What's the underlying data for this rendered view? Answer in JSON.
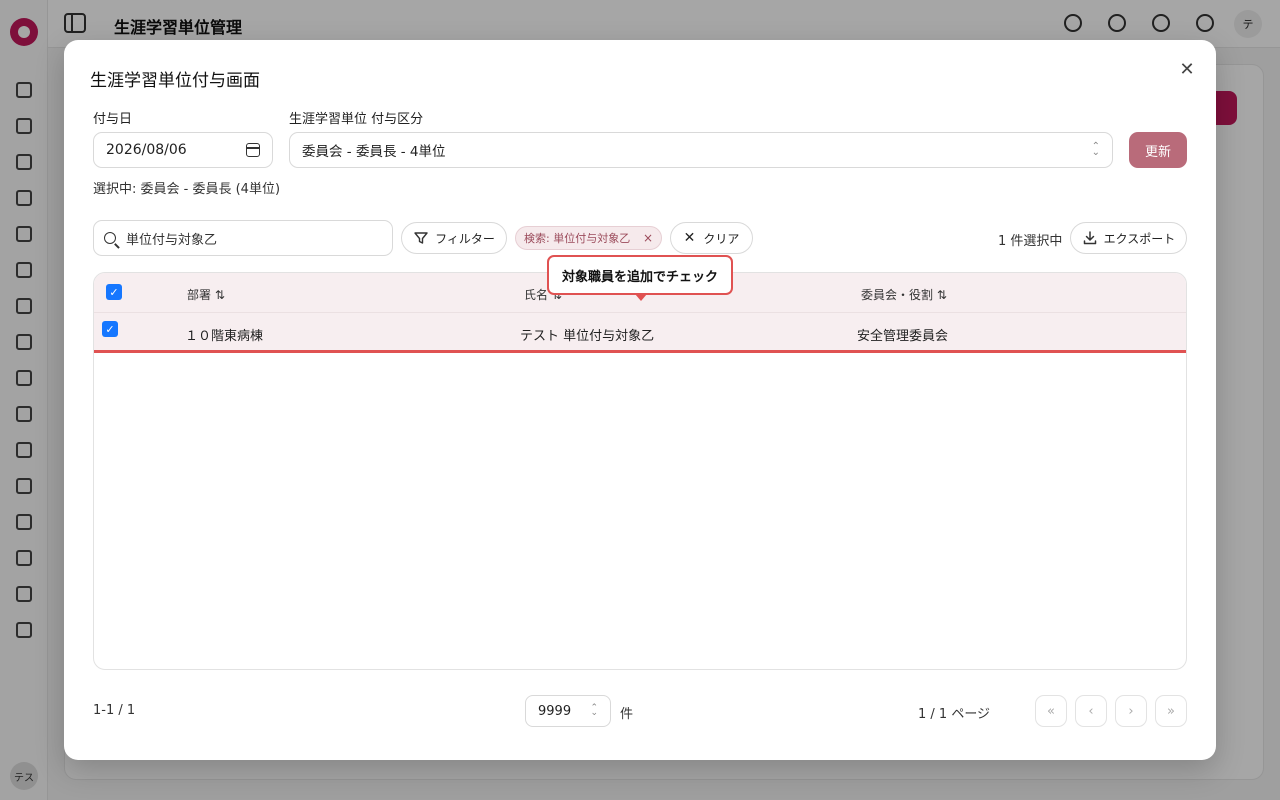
{
  "app": {
    "title": "生涯学習単位管理",
    "user_initials": "テ",
    "sidebar_user_initials": "テス"
  },
  "dialog": {
    "title": "生涯学習単位付与画面",
    "close_glyph": "✕",
    "date_label": "付与日",
    "date_value": "2026/08/06",
    "category_label": "生涯学習単位 付与区分",
    "category_value": "委員会 - 委員長 - 4単位",
    "update_label": "更新",
    "selected_info": "選択中: 委員会 - 委員長 (4単位)"
  },
  "toolbar": {
    "search_value": "単位付与対象乙",
    "filter_label": "フィルター",
    "chip_label": "検索: 単位付与対象乙",
    "chip_close": "×",
    "clear_label": "クリア",
    "clear_glyph": "✕",
    "selection_count": "1 件選択中",
    "export_label": "エクスポート"
  },
  "table": {
    "headers": [
      "部署 ⇅",
      "氏名 ⇅",
      "委員会・役割 ⇅"
    ],
    "rows": [
      {
        "checked": true,
        "cells": [
          "１０階東病棟",
          "テスト 単位付与対象乙",
          "安全管理委員会"
        ]
      }
    ],
    "header_checked": true,
    "check_glyph": "✓"
  },
  "tooltip": {
    "text": "対象職員を追加でチェック"
  },
  "pagination": {
    "range": "1-1 / 1",
    "page_size": "9999",
    "page_size_unit": "件",
    "page_info": "1 / 1 ページ",
    "first": "«",
    "prev": "‹",
    "next": "›",
    "last": "»"
  },
  "colors": {
    "accent": "#b96b7a",
    "highlight": "#e05252",
    "checkbox": "#1677ff"
  }
}
